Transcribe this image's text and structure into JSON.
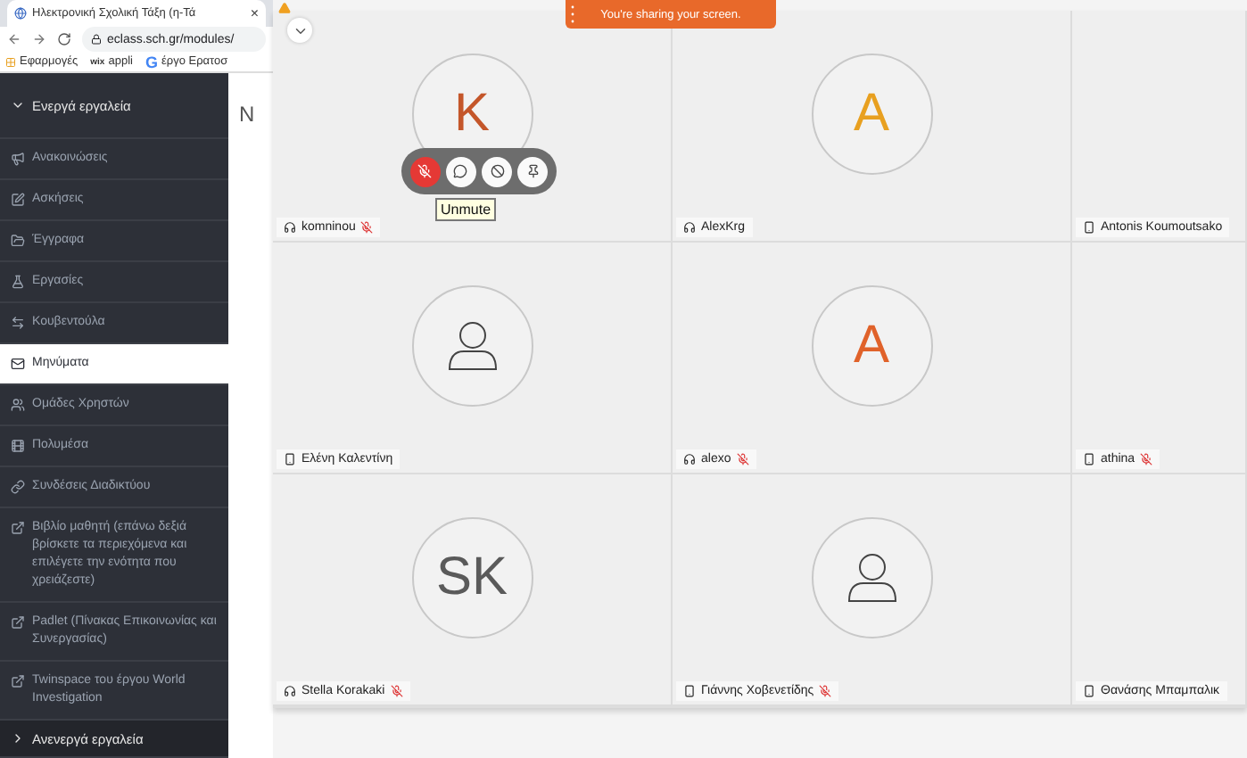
{
  "browser": {
    "tab_title": "Ηλεκτρονική Σχολική Τάξη (η-Τά",
    "tab_close": "×",
    "address": "eclass.sch.gr/modules/",
    "bookmarks": [
      {
        "kind": "apps",
        "label": "Εφαρμογές"
      },
      {
        "kind": "wix",
        "label": "appli",
        "logo": "wix"
      },
      {
        "kind": "google",
        "label": "έργο Ερατοσ",
        "logo": "G"
      }
    ]
  },
  "sidebar": {
    "active_group": {
      "label": "Ενεργά εργαλεία",
      "expanded": true
    },
    "items": [
      {
        "label": "Ανακοινώσεις",
        "selected": false
      },
      {
        "label": "Ασκήσεις",
        "selected": false
      },
      {
        "label": "Έγγραφα",
        "selected": false
      },
      {
        "label": "Εργασίες",
        "selected": false
      },
      {
        "label": "Κουβεντούλα",
        "selected": false
      },
      {
        "label": "Μηνύματα",
        "selected": true
      },
      {
        "label": "Ομάδες Χρηστών",
        "selected": false
      },
      {
        "label": "Πολυμέσα",
        "selected": false
      },
      {
        "label": "Συνδέσεις Διαδικτύου",
        "selected": false
      },
      {
        "label": "Βιβλίο μαθητή (επάνω δεξιά βρίσκετε τα περιεχόμενα και επιλέγετε την ενότητα που χρειάζεστε)",
        "selected": false
      },
      {
        "label": "Padlet (Πίνακας Επικοινωνίας και Συνεργασίας)",
        "selected": false
      },
      {
        "label": "Twinspace του έργου World Investigation",
        "selected": false
      }
    ],
    "inactive_group": {
      "label": "Ανενεργά εργαλεία",
      "expanded": false
    }
  },
  "page_heading": "N",
  "meeting": {
    "banner": "You're sharing your screen.",
    "tooltip": "Unmute",
    "tiles": [
      {
        "name": "komninou",
        "kind": "headset",
        "muted": true,
        "avatar": {
          "kind": "initials",
          "text": "K",
          "color": "#c4562a"
        },
        "controls": true
      },
      {
        "name": "AlexKrg",
        "kind": "headset",
        "muted": false,
        "avatar": {
          "kind": "initials",
          "text": "A",
          "color": "#e8a020"
        },
        "controls": false
      },
      {
        "name": "Antonis Koumoutsako",
        "kind": "phone",
        "muted": false,
        "controls": false
      },
      {
        "name": "Ελένη Καλεντίνη",
        "kind": "phone",
        "muted": false,
        "avatar": {
          "kind": "person"
        },
        "controls": false
      },
      {
        "name": "alexo",
        "kind": "headset",
        "muted": true,
        "avatar": {
          "kind": "initials",
          "text": "A",
          "color": "#e0622a"
        },
        "controls": false
      },
      {
        "name": "athina",
        "kind": "phone",
        "muted": true,
        "controls": false
      },
      {
        "name": "Stella Korakaki",
        "kind": "headset",
        "muted": true,
        "avatar": {
          "kind": "initials",
          "text": "SK",
          "color": "#5a5a5a"
        },
        "controls": false
      },
      {
        "name": "Γιάννης Χοβενετίδης",
        "kind": "phone",
        "muted": true,
        "avatar": {
          "kind": "person"
        },
        "controls": false
      },
      {
        "name": "Θανάσης Μπαμπαλικ",
        "kind": "phone",
        "muted": false,
        "controls": false
      }
    ]
  }
}
